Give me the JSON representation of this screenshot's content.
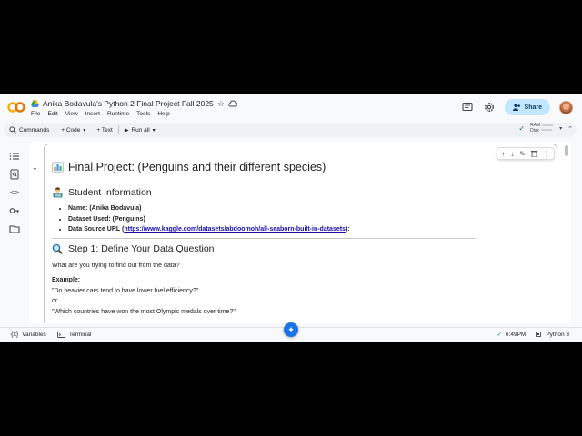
{
  "header": {
    "title": "Anika Bodavula's Python 2 Final Project Fall 2025",
    "menu": [
      "File",
      "Edit",
      "View",
      "Insert",
      "Runtime",
      "Tools",
      "Help"
    ],
    "share_label": "Share",
    "brand_colors": {
      "logo_orange": "#f9ab00",
      "logo_yellow": "#e37400",
      "share_bg": "#c2e7ff"
    }
  },
  "toolbar": {
    "commands": "Commands",
    "code": "+ Code",
    "text": "+ Text",
    "run_all": "Run all",
    "ram": "RAM",
    "disk": "Disk"
  },
  "cell": {
    "heading": "Final Project: (Penguins and their different species)",
    "student_info_heading": "Student Information",
    "items": [
      {
        "label": "Name: (Anika Bodavula)"
      },
      {
        "label": "Dataset Used: (Penguins)"
      }
    ],
    "data_source_label": "Data Source URL (",
    "data_source_url": "https://www.kaggle.com/datasets/abdoomoh/all-seaborn-built-in-datasets",
    "data_source_suffix": "):",
    "step1_heading": "Step 1: Define Your Data Question",
    "step1_prompt": "What are you trying to find out from the data?",
    "example_label": "Example:",
    "example_1": "\"Do heavier cars tend to have lower fuel efficiency?\"",
    "or_text": "or",
    "example_2": "\"Which countries have won the most Olympic medals over time?\""
  },
  "statusbar": {
    "variables": "Variables",
    "terminal": "Terminal",
    "time": "6:49PM",
    "runtime": "Python 3"
  }
}
